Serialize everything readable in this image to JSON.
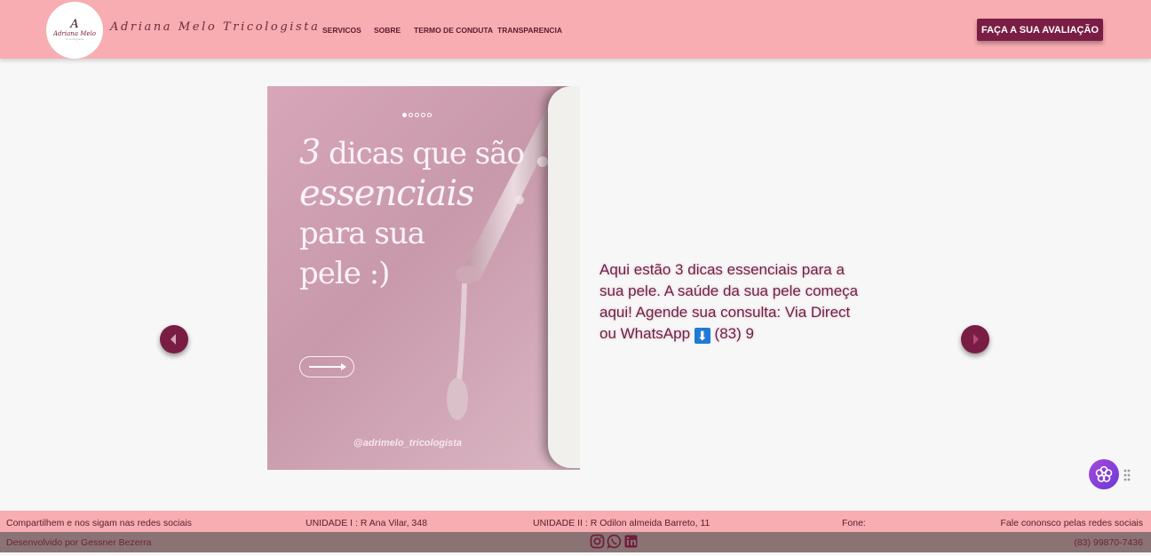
{
  "header": {
    "logo": {
      "mark": "A",
      "text": "Adriana Melo",
      "sub": "Tricologista"
    },
    "brand": "Adriana Melo Tricologista",
    "nav": [
      "SERVICOS",
      "SOBRE",
      "TERMO DE CONDUTA",
      "TRANSPARENCIA"
    ],
    "cta": "FAÇA A SUA AVALIAÇÃO"
  },
  "post": {
    "headline_line1_a": "3",
    "headline_line1_b": "dicas que são",
    "headline_line2": "essenciais",
    "headline_line3": "para sua",
    "headline_line4": "pele :)",
    "handle": "@adrimelo_tricologista",
    "slide_count": 5,
    "active_slide": 1,
    "caption_text": "Aqui estão 3 dicas essenciais para a sua pele. A saúde da sua pele começa aqui! Agende sua consulta: Via Direct ou WhatsApp",
    "caption_arrow": "⬇",
    "caption_phone": "(83) 9"
  },
  "carousel": {
    "prev_icon": "caret-left-icon",
    "next_icon": "caret-right-icon"
  },
  "footer": {
    "share": "Compartilhem e nos sigam nas redes sociais",
    "unit1": "UNIDADE I : R Ana Vilar, 348",
    "unit2": "UNIDADE II : R Odilon almeida Barreto, 11",
    "phone_label": "Fone:",
    "contact": "Fale cononsco pelas redes sociais",
    "developer": "Desenvolvido por Gessner Bezerra",
    "phone": "(83) 99870-7436",
    "social_icons": [
      "instagram-icon",
      "whatsapp-icon",
      "linkedin-icon"
    ]
  },
  "colors": {
    "header_bg": "#f7adb1",
    "accent": "#7a1d45",
    "footer_bottom": "#8a7373",
    "page_bg": "#f7f7f7"
  }
}
